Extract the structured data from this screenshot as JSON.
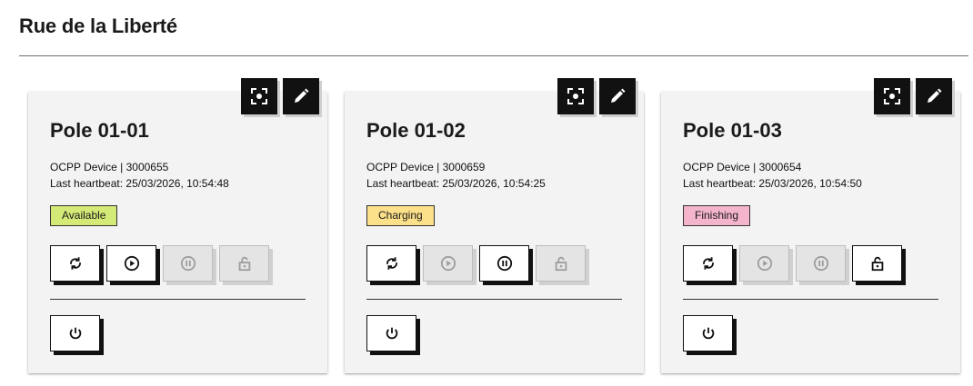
{
  "page": {
    "title": "Rue de la Liberté"
  },
  "icons": {
    "focus": "focus-frame-icon",
    "edit": "pencil-icon",
    "reset": "refresh-icon",
    "start": "play-circle-icon",
    "stop": "pause-circle-icon",
    "unlock": "unlock-icon",
    "power": "power-icon"
  },
  "colors": {
    "available": "#d4ea77",
    "charging": "#fde08a",
    "finishing": "#f4b4cc"
  },
  "poles": [
    {
      "name": "Pole 01-01",
      "device": "OCPP Device | 3000655",
      "heartbeat": "Last heartbeat: 25/03/2026, 10:54:48",
      "status": "Available",
      "start_enabled": true,
      "stop_enabled": false,
      "unlock_enabled": false
    },
    {
      "name": "Pole 01-02",
      "device": "OCPP Device | 3000659",
      "heartbeat": "Last heartbeat: 25/03/2026, 10:54:25",
      "status": "Charging",
      "start_enabled": false,
      "stop_enabled": true,
      "unlock_enabled": false
    },
    {
      "name": "Pole 01-03",
      "device": "OCPP Device | 3000654",
      "heartbeat": "Last heartbeat: 25/03/2026, 10:54:50",
      "status": "Finishing",
      "start_enabled": false,
      "stop_enabled": false,
      "unlock_enabled": true
    }
  ]
}
